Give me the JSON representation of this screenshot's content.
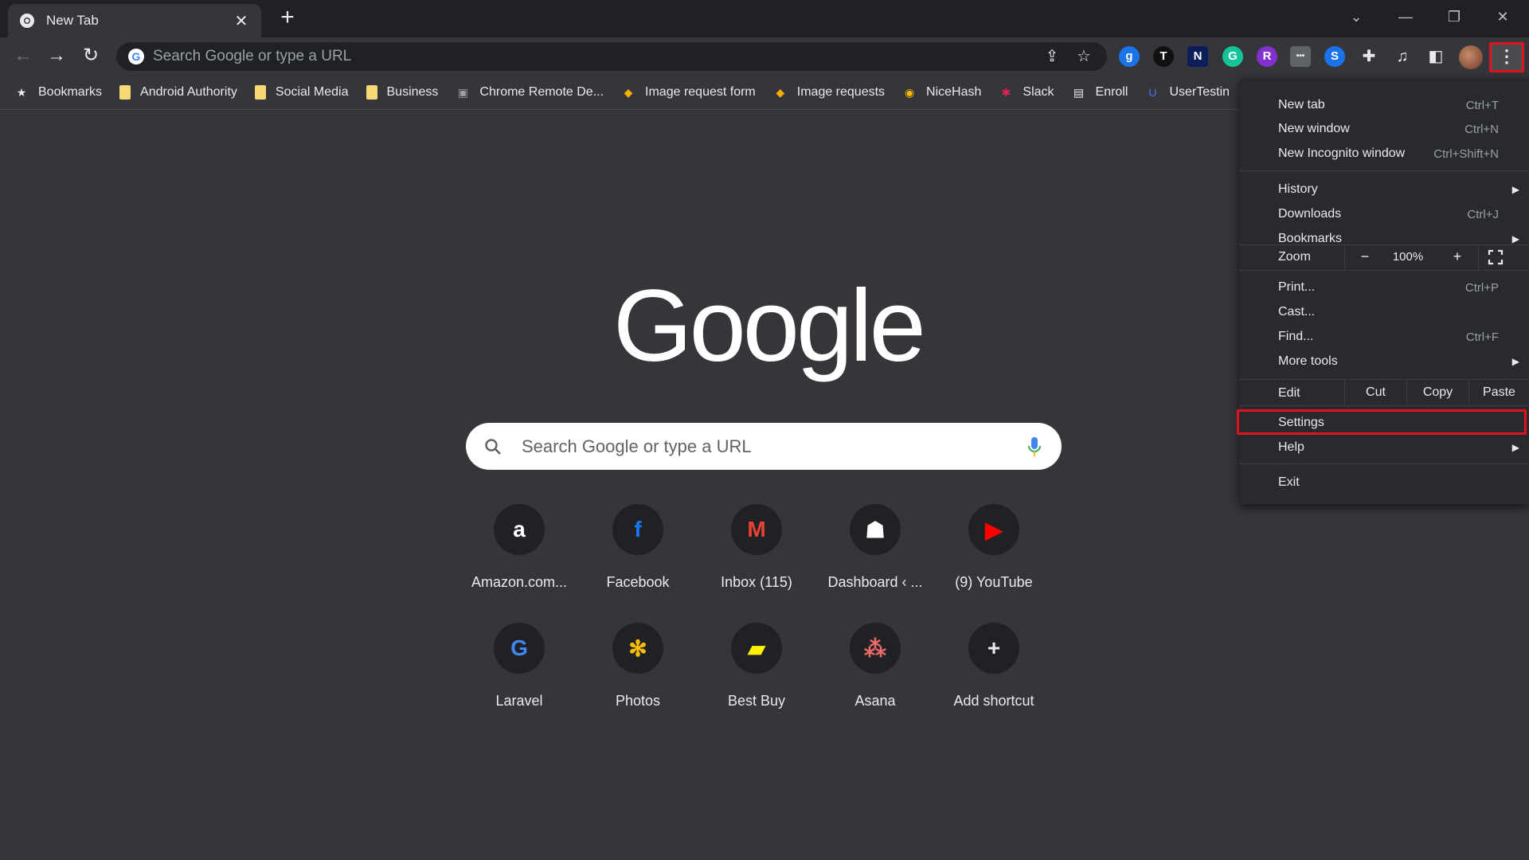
{
  "tab": {
    "title": "New Tab",
    "close": "✕"
  },
  "newtab": "+",
  "window": {
    "minimize": "—",
    "restore": "❐",
    "close": "✕",
    "tablist": "⌄"
  },
  "omnibox": {
    "placeholder": "Search Google or type a URL"
  },
  "extensions": [
    {
      "letter": "g",
      "color": "#1a73e8"
    },
    {
      "letter": "T",
      "color": "#111111"
    },
    {
      "letter": "N",
      "color": "#0b1e5b"
    },
    {
      "letter": "G",
      "color": "#15c39a"
    },
    {
      "letter": "R",
      "color": "#8430ce"
    },
    {
      "letter": "•••",
      "color": "#5f6368"
    },
    {
      "letter": "S",
      "color": "#1a73e8"
    }
  ],
  "bookmarks": [
    {
      "label": "Bookmarks",
      "icon": "star-icon"
    },
    {
      "label": "Android Authority",
      "icon": "folder-icon"
    },
    {
      "label": "Social Media",
      "icon": "folder-icon"
    },
    {
      "label": "Business",
      "icon": "folder-icon"
    },
    {
      "label": "Chrome Remote De...",
      "icon": "remote-desktop-icon"
    },
    {
      "label": "Image request form",
      "icon": "cube-icon"
    },
    {
      "label": "Image requests",
      "icon": "cube-icon"
    },
    {
      "label": "NiceHash",
      "icon": "nicehash-icon"
    },
    {
      "label": "Slack",
      "icon": "slack-icon"
    },
    {
      "label": "Enroll",
      "icon": "enroll-icon"
    },
    {
      "label": "UserTestin",
      "icon": "usertesting-icon"
    }
  ],
  "search": {
    "placeholder": "Search Google or type a URL"
  },
  "logo": "Google",
  "shortcuts": [
    {
      "label": "Amazon.com...",
      "glyph": "a",
      "color": "#ffffff"
    },
    {
      "label": "Facebook",
      "glyph": "f",
      "color": "#1877f2"
    },
    {
      "label": "Inbox (115)",
      "glyph": "M",
      "color": "#ea4335"
    },
    {
      "label": "Dashboard ‹ ...",
      "glyph": "☗",
      "color": "#ffffff"
    },
    {
      "label": "(9) YouTube",
      "glyph": "▶",
      "color": "#ff0000"
    },
    {
      "label": "Laravel",
      "glyph": "G",
      "color": "#4285f4"
    },
    {
      "label": "Photos",
      "glyph": "✻",
      "color": "#fbbc04"
    },
    {
      "label": "Best Buy",
      "glyph": "▰",
      "color": "#fff200"
    },
    {
      "label": "Asana",
      "glyph": "⁂",
      "color": "#f06a6a"
    },
    {
      "label": "Add shortcut",
      "glyph": "+",
      "color": "#e8eaed"
    }
  ],
  "menu": {
    "new_tab": "New tab",
    "new_tab_sc": "Ctrl+T",
    "new_window": "New window",
    "new_window_sc": "Ctrl+N",
    "new_incognito": "New Incognito window",
    "new_incognito_sc": "Ctrl+Shift+N",
    "history": "History",
    "downloads": "Downloads",
    "downloads_sc": "Ctrl+J",
    "bookmarks": "Bookmarks",
    "zoom": "Zoom",
    "zoom_minus": "−",
    "zoom_value": "100%",
    "zoom_plus": "+",
    "print": "Print...",
    "print_sc": "Ctrl+P",
    "cast": "Cast...",
    "find": "Find...",
    "find_sc": "Ctrl+F",
    "more_tools": "More tools",
    "edit": "Edit",
    "cut": "Cut",
    "copy": "Copy",
    "paste": "Paste",
    "settings": "Settings",
    "help": "Help",
    "exit": "Exit"
  }
}
